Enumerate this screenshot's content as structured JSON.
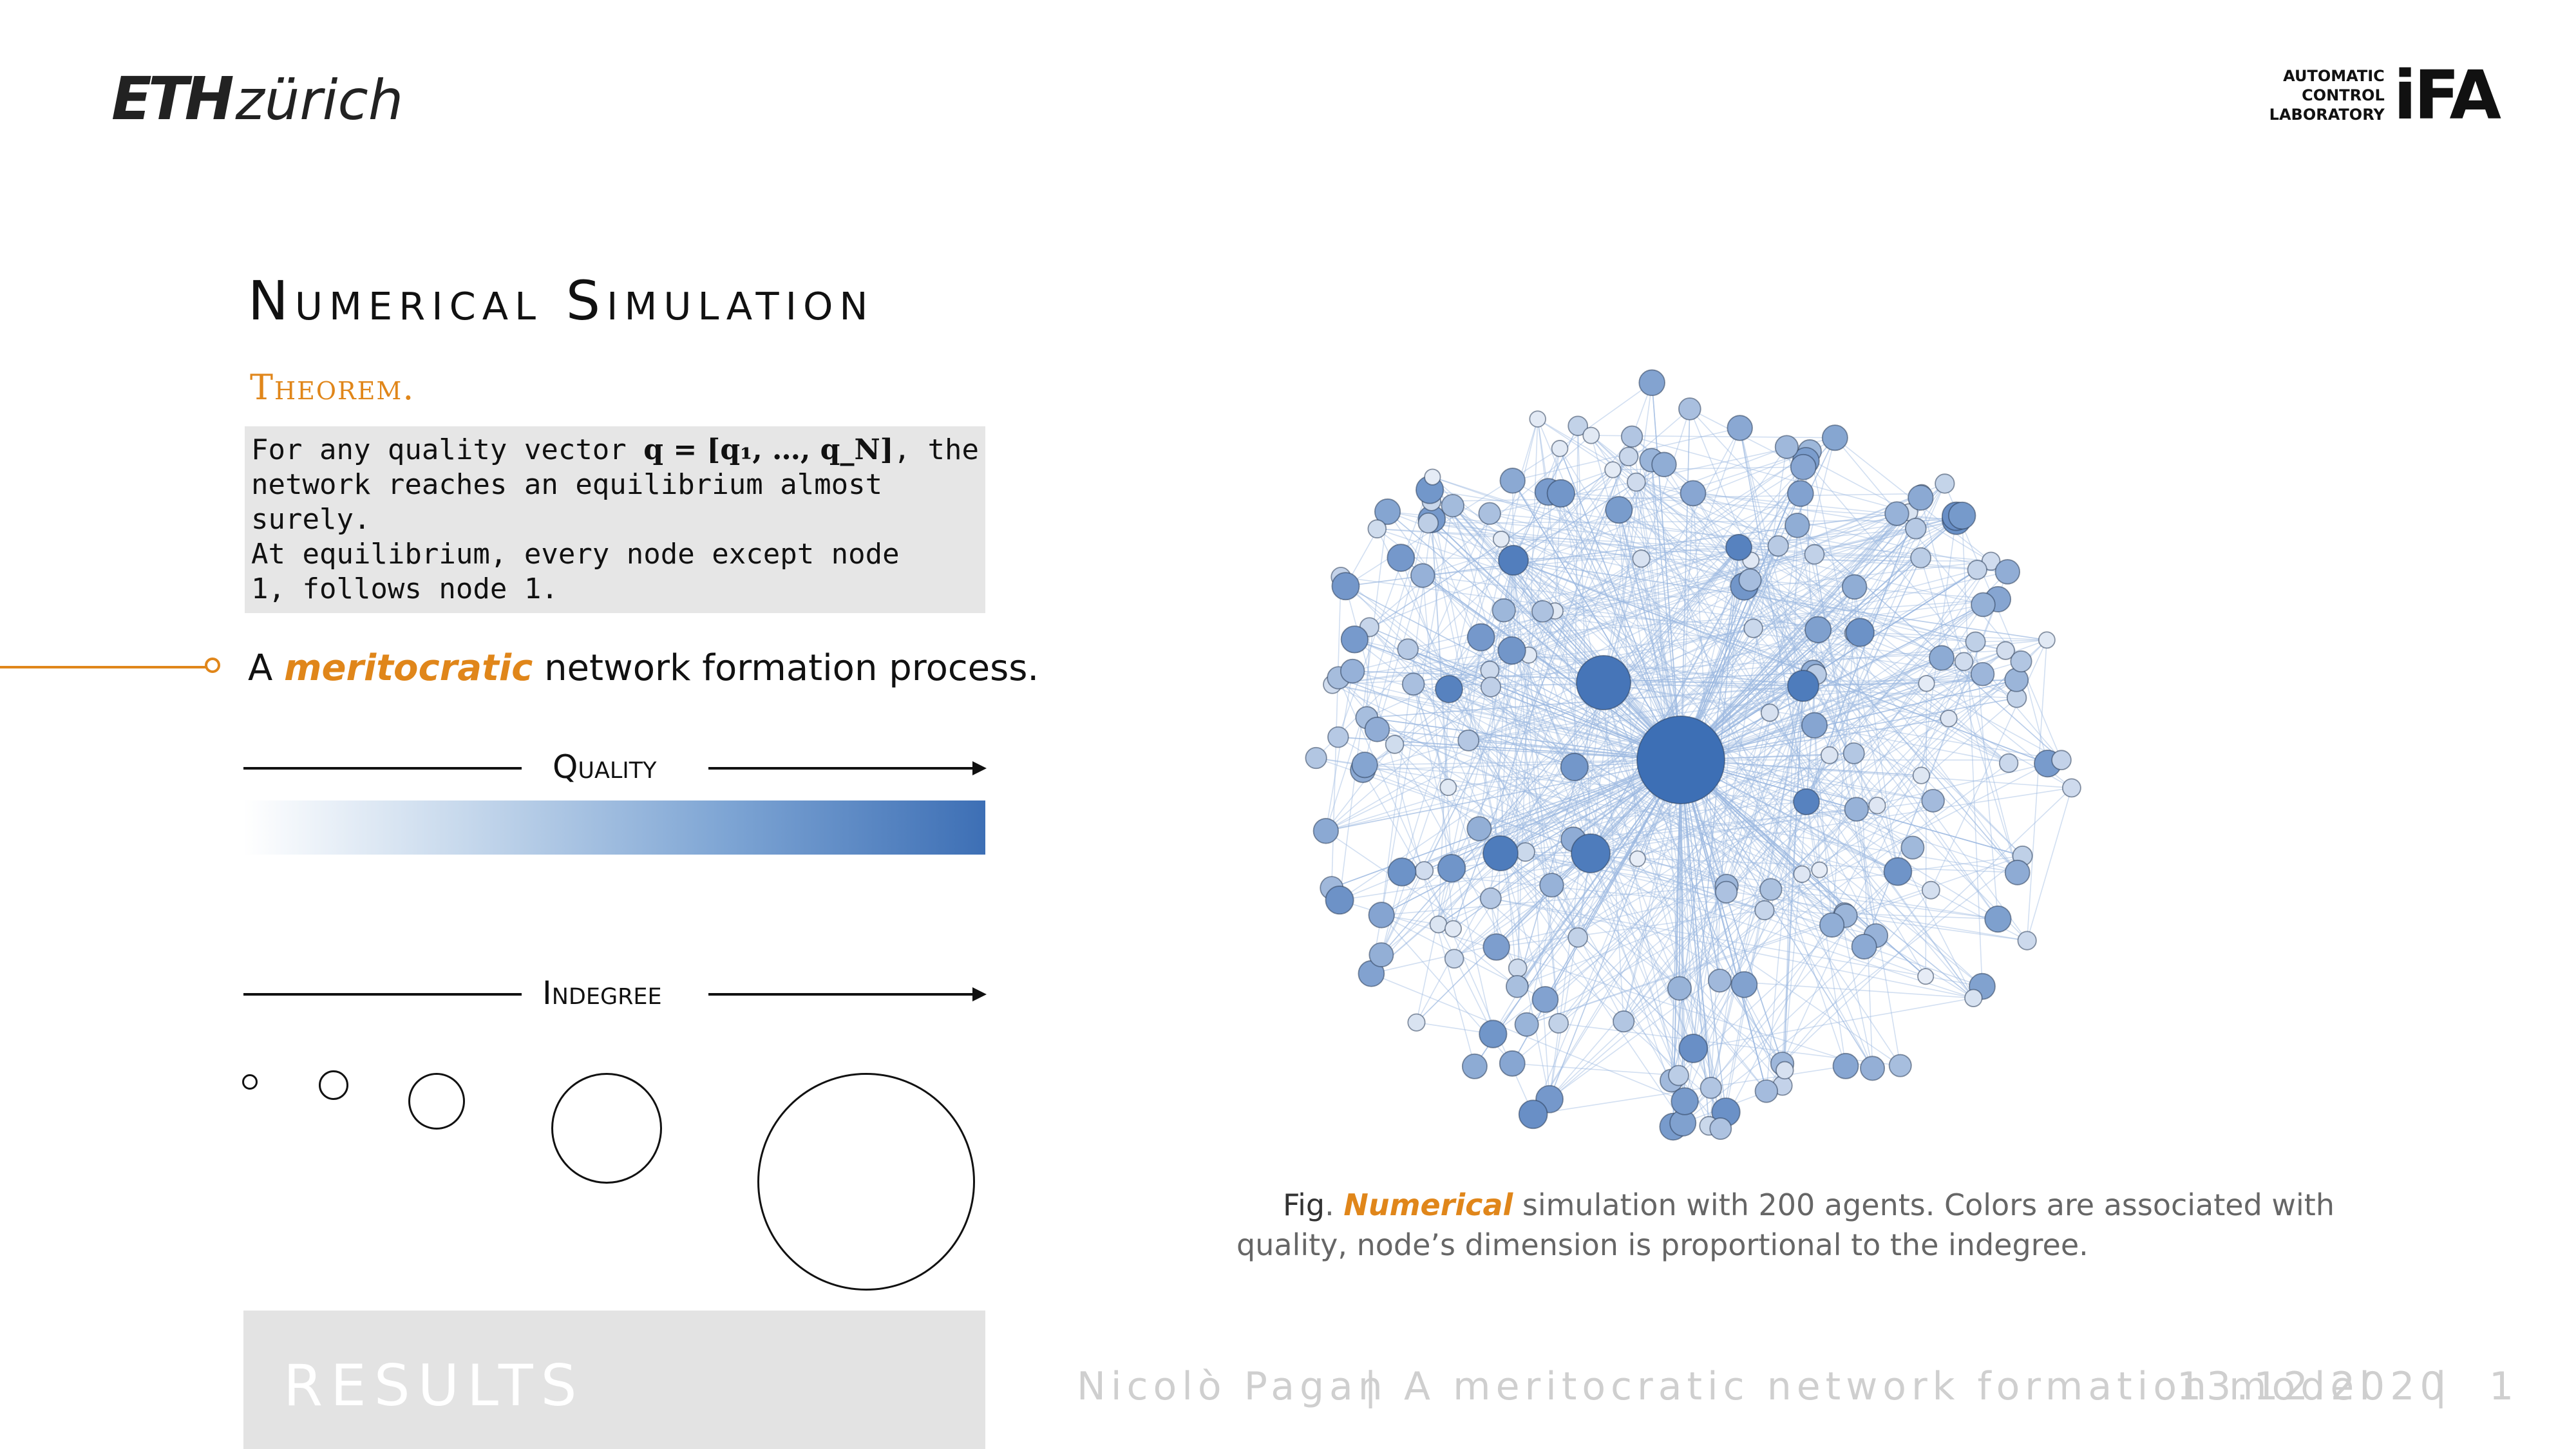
{
  "header": {
    "logo_eth_bold": "ETH",
    "logo_eth_rest": "zürich",
    "lab_line1": "AUTOMATIC",
    "lab_line2": "CONTROL",
    "lab_line3": "LABORATORY",
    "lab_mark": "iFA"
  },
  "slide": {
    "title": "Numerical Simulation",
    "theorem_label": "Theorem.",
    "theorem_text": {
      "line1_pre": "For any quality vector ",
      "line1_math": "q = [q₁, …, q_N]",
      "line1_post": ", the",
      "line2": "network reaches an equilibrium almost",
      "line3": "surely.",
      "line4": "At equilibrium, every node except node",
      "line5": "1, follows node 1."
    },
    "process_pre": "A ",
    "process_em": "meritocratic",
    "process_post": " network formation process.",
    "quality_label": "Quality",
    "indegree_label": "Indegree",
    "section": "RESULTS"
  },
  "caption": {
    "fig": "Fig",
    "sep": ". ",
    "em": "Numerical",
    "rest": " simulation with 200 agents. Colors are associated with quality, node’s dimension is proportional to the indegree."
  },
  "footer": {
    "author": "Nicolò Pagan",
    "sep1": "|",
    "talk_title": "A meritocratic network formation model",
    "date": "13.12.2020",
    "sep2": "|",
    "page": "1"
  },
  "colors": {
    "accent": "#e0861a",
    "node_dark": "#3d6fb5",
    "node_light": "#e8eef7",
    "edge": "#9bb8e0"
  }
}
